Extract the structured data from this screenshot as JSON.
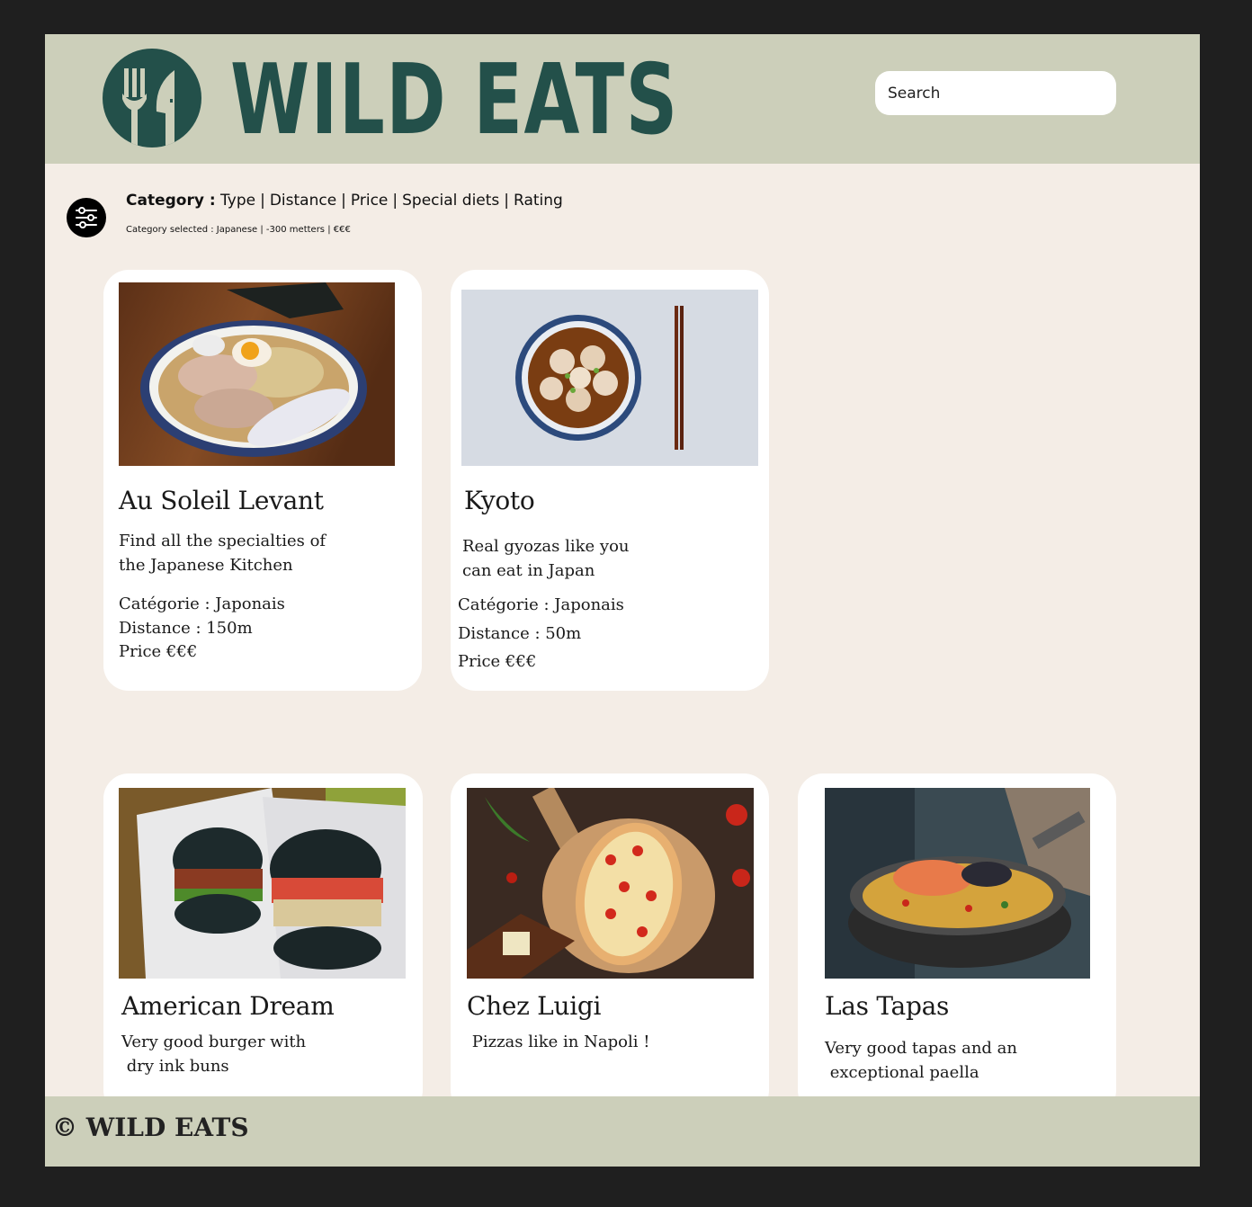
{
  "header": {
    "brand": "WILD EATS",
    "search_placeholder": "Search"
  },
  "filters": {
    "category_label": "Category :",
    "options": [
      "Type",
      "Distance",
      "Price",
      "Special diets",
      "Rating"
    ],
    "selected_text": "Category selected : Japanese | -300 metters | €€€"
  },
  "restaurants": [
    {
      "name": "Au Soleil Levant",
      "description": "Find all the specialties of\nthe Japanese Kitchen",
      "category": "Catégorie : Japonais",
      "distance": "Distance : 150m",
      "price": "Price €€€",
      "image": "ramen-photo"
    },
    {
      "name": "Kyoto",
      "description": "Real gyozas like you\ncan eat in Japan",
      "category": "Catégorie : Japonais",
      "distance": "Distance : 50m",
      "price": "Price €€€",
      "image": "gyoza-bowl-photo"
    },
    {
      "name": "American Dream",
      "description": "Very good burger with\n dry ink buns",
      "image": "black-burger-photo"
    },
    {
      "name": "Chez Luigi",
      "description": " Pizzas like in Napoli !",
      "image": "pizza-photo"
    },
    {
      "name": "Las Tapas",
      "description": "Very good tapas and an\n exceptional paella",
      "image": "paella-photo"
    }
  ],
  "footer": {
    "text": "© WILD EATS"
  },
  "colors": {
    "header_bg": "#cccfba",
    "page_bg": "#f4ede6",
    "brand_green": "#23504a",
    "outer_bg": "#1f1f1f"
  }
}
